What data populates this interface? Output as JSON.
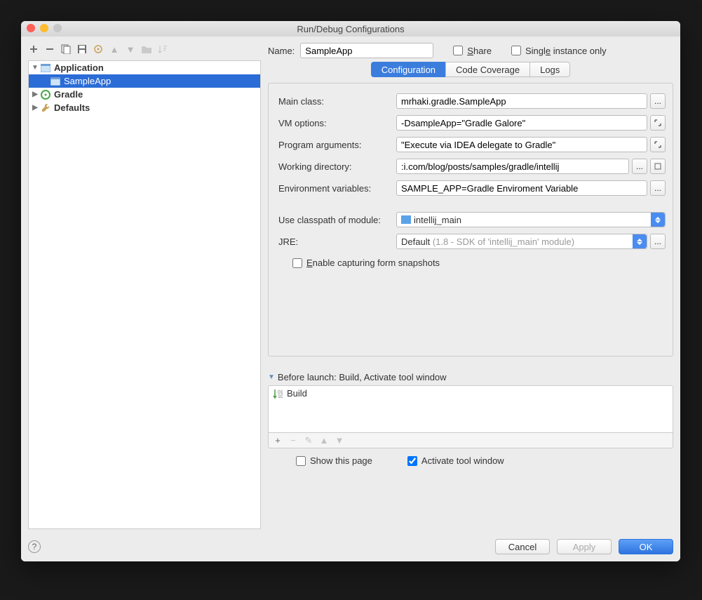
{
  "window": {
    "title": "Run/Debug Configurations"
  },
  "header": {
    "name_label": "Name:",
    "name_value": "SampleApp",
    "share_label": "Share",
    "single_instance_label": "Single instance only"
  },
  "tree": {
    "items": [
      {
        "label": "Application",
        "bold": true
      },
      {
        "label": "SampleApp",
        "bold": false
      },
      {
        "label": "Gradle",
        "bold": true
      },
      {
        "label": "Defaults",
        "bold": true
      }
    ]
  },
  "tabs": {
    "configuration": "Configuration",
    "coverage": "Code Coverage",
    "logs": "Logs"
  },
  "form": {
    "main_class_label": "Main class:",
    "main_class_value": "mrhaki.gradle.SampleApp",
    "vm_label": "VM options:",
    "vm_value": "-DsampleApp=\"Gradle Galore\"",
    "args_label": "Program arguments:",
    "args_value": "\"Execute via IDEA delegate to Gradle\"",
    "wd_label": "Working directory:",
    "wd_value": ":i.com/blog/posts/samples/gradle/intellij",
    "env_label": "Environment variables:",
    "env_value": "SAMPLE_APP=Gradle Enviroment Variable",
    "classpath_label": "Use classpath of module:",
    "classpath_value": "intellij_main",
    "jre_label": "JRE:",
    "jre_value": "Default",
    "jre_hint": "(1.8 - SDK of 'intellij_main' module)",
    "snapshots_label": "Enable capturing form snapshots",
    "ellipsis": "..."
  },
  "before": {
    "header": "Before launch: Build, Activate tool window",
    "items": [
      {
        "label": "Build"
      }
    ]
  },
  "options": {
    "show_page": "Show this page",
    "activate_window": "Activate tool window"
  },
  "footer": {
    "cancel": "Cancel",
    "apply": "Apply",
    "ok": "OK"
  }
}
